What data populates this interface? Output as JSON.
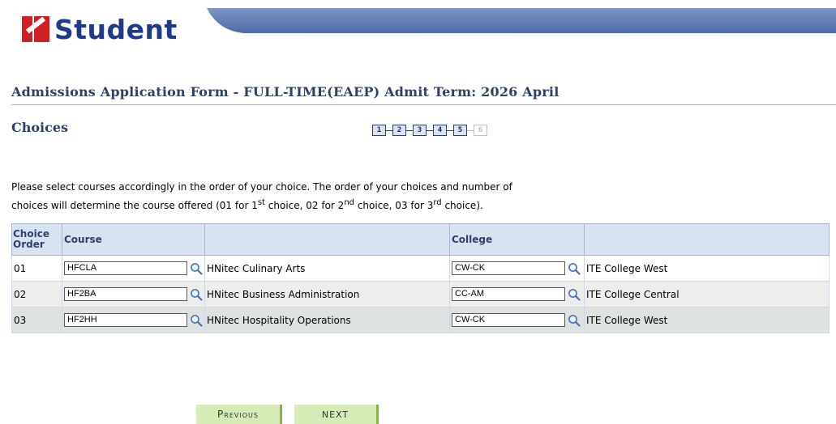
{
  "brand": {
    "logo_text": "Student",
    "logo_color": "#d21f26",
    "text_color": "#1f3a8a",
    "banner_color": "#5f79b2"
  },
  "page": {
    "title": "Admissions Application Form - FULL-TIME(EAEP)   Admit Term: 2026 April",
    "section": "Choices"
  },
  "steps": [
    {
      "label": "1",
      "active": true
    },
    {
      "label": "2",
      "active": true
    },
    {
      "label": "3",
      "active": true
    },
    {
      "label": "4",
      "active": true
    },
    {
      "label": "5",
      "active": true
    },
    {
      "label": "6",
      "active": false
    }
  ],
  "instructions": {
    "line1": "Please select courses accordingly in the order of your choice. The order of your choices and number of",
    "line2_a": "choices will determine the course offered (01 for 1",
    "sup1": "st",
    "line2_b": " choice, 02 for 2",
    "sup2": "nd",
    "line2_c": " choice, 03 for 3",
    "sup3": "rd",
    "line2_d": " choice)."
  },
  "table": {
    "headers": {
      "choice_order_1": "Choice",
      "choice_order_2": "Order",
      "course": "Course",
      "course_desc": "",
      "college": "College",
      "college_desc": ""
    },
    "rows": [
      {
        "order": "01",
        "course_code": "HFCLA",
        "course_name": "HNitec Culinary Arts",
        "college_code": "CW-CK",
        "college_name": "ITE College West"
      },
      {
        "order": "02",
        "course_code": "HF2BA",
        "course_name": "HNitec Business Administration",
        "college_code": "CC-AM",
        "college_name": "ITE College Central"
      },
      {
        "order": "03",
        "course_code": "HF2HH",
        "course_name": "HNitec Hospitality Operations",
        "college_code": "CW-CK",
        "college_name": "ITE College West"
      }
    ]
  },
  "buttons": {
    "previous": "Previous",
    "next": "NEXT"
  },
  "icons": {
    "lookup": "magnifier-icon"
  }
}
